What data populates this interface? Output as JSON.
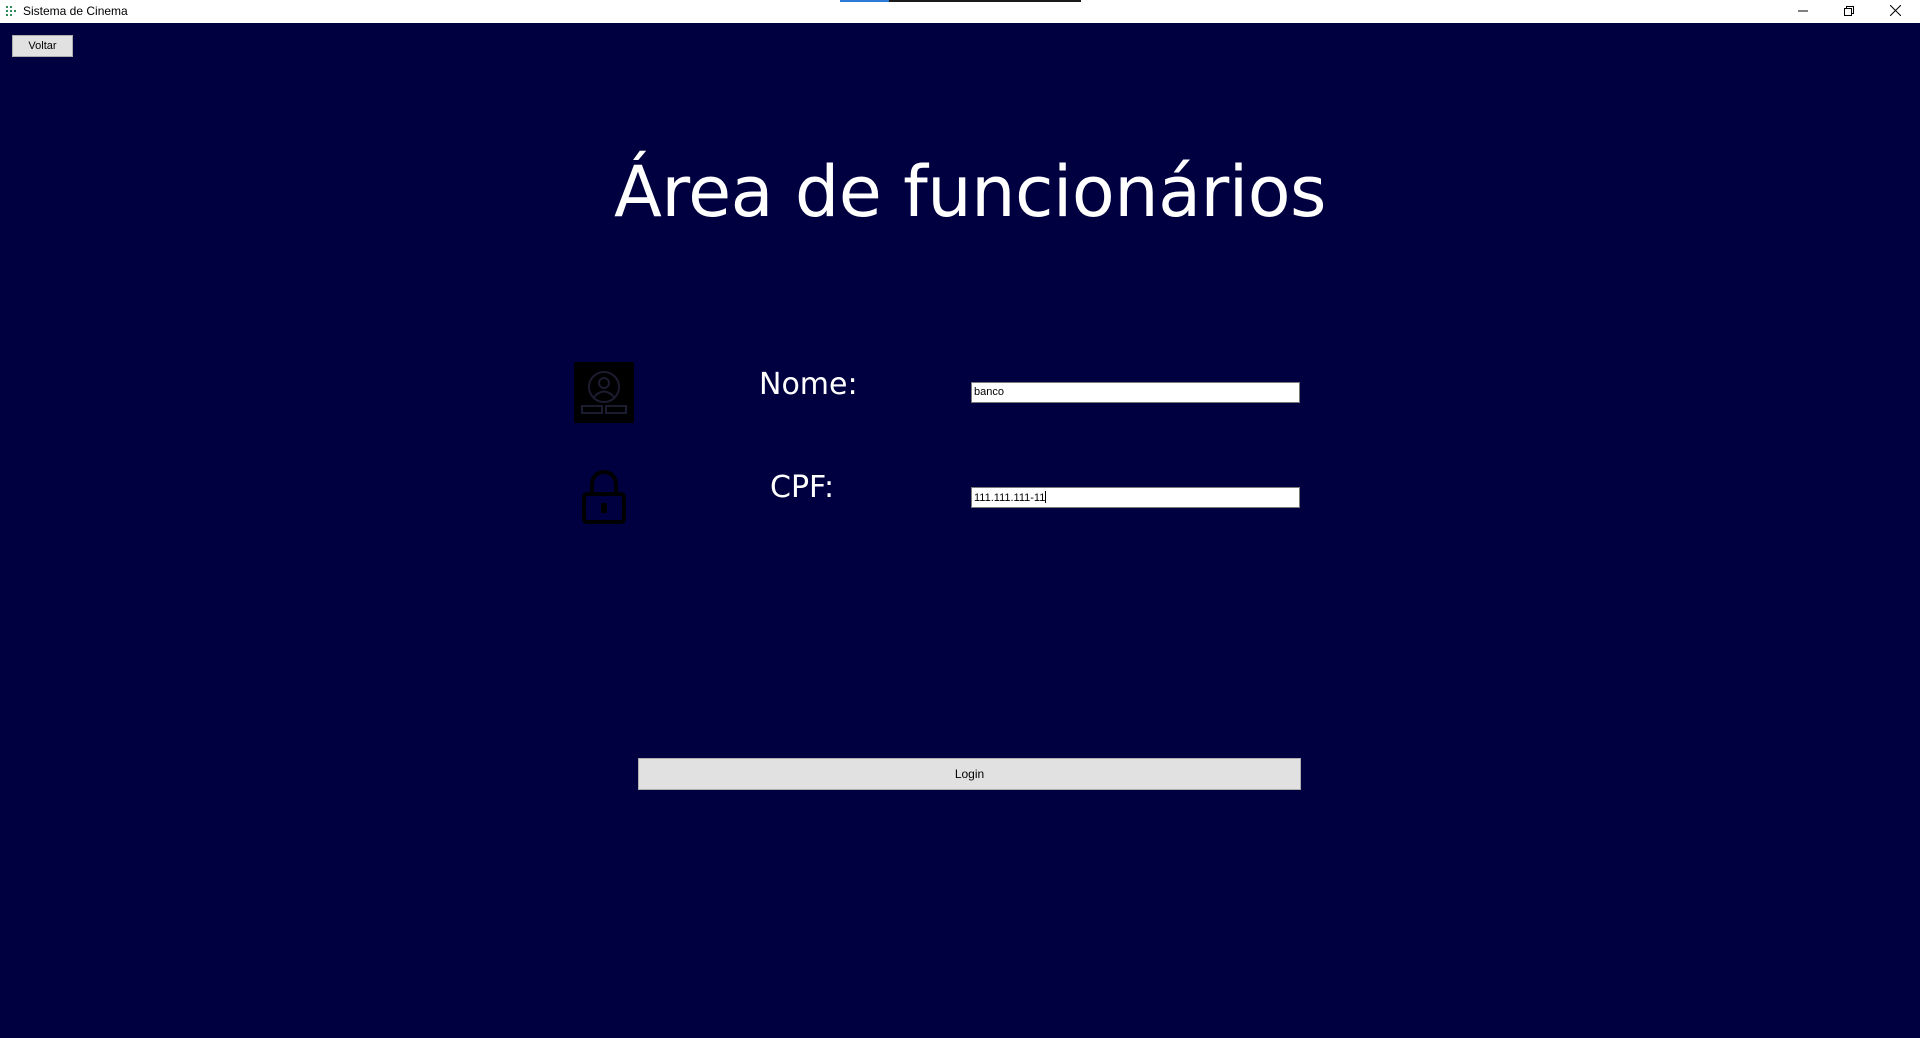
{
  "window": {
    "title": "Sistema de Cinema",
    "app_icon": "grid-app-icon",
    "controls": {
      "minimize_icon": "minimize-icon",
      "restore_icon": "restore-icon",
      "close_icon": "close-icon"
    },
    "background_color": "#000040"
  },
  "toolbar": {
    "back_label": "Voltar"
  },
  "main": {
    "heading": "Área de funcionários",
    "form": {
      "nome": {
        "icon": "user-badge-icon",
        "label": "Nome:",
        "value": "banco"
      },
      "cpf": {
        "icon": "lock-icon",
        "label": "CPF:",
        "value": "111.111.111-11"
      }
    },
    "login_label": "Login"
  }
}
